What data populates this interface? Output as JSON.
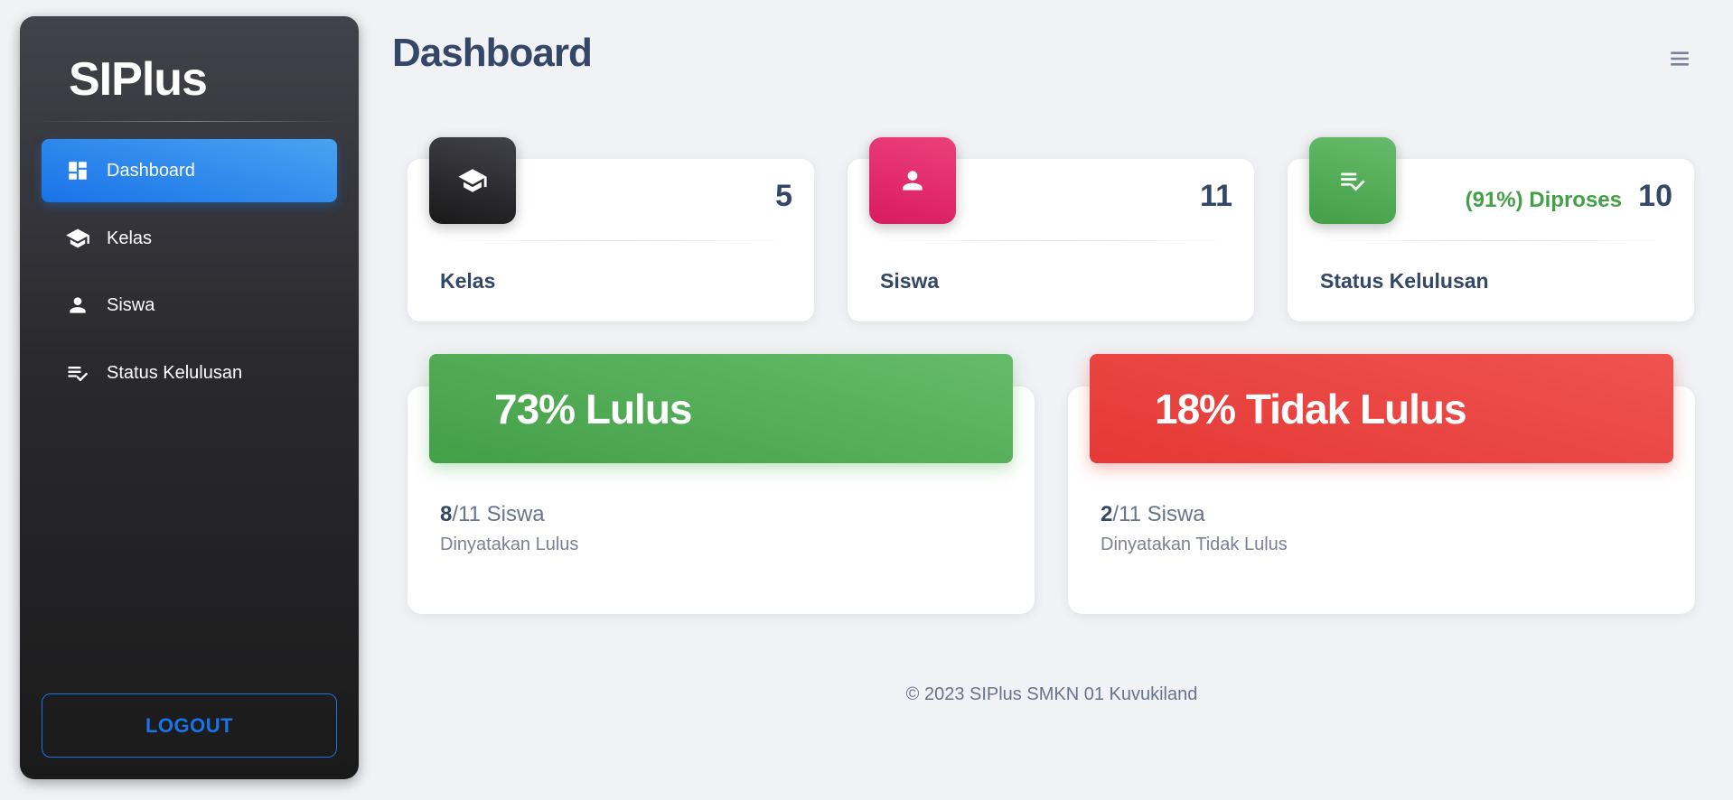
{
  "sidebar": {
    "brand": "SIPlus",
    "items": [
      {
        "label": "Dashboard",
        "icon": "dashboard-icon",
        "active": true
      },
      {
        "label": "Kelas",
        "icon": "school-icon",
        "active": false
      },
      {
        "label": "Siswa",
        "icon": "person-icon",
        "active": false
      },
      {
        "label": "Status Kelulusan",
        "icon": "checklist-icon",
        "active": false
      }
    ],
    "logout_label": "LOGOUT"
  },
  "header": {
    "title": "Dashboard",
    "menu_icon": "menu-icon"
  },
  "stats": [
    {
      "label": "Kelas",
      "value": "5",
      "icon": "school-icon",
      "color": "#222222"
    },
    {
      "label": "Siswa",
      "value": "11",
      "icon": "person-icon",
      "color": "#e91e63"
    },
    {
      "label": "Status Kelulusan",
      "value": "10",
      "extra": "(91%) Diproses",
      "icon": "checklist-icon",
      "color": "#4caf50"
    }
  ],
  "results": [
    {
      "title": "73% Lulus",
      "count": "8",
      "total": "/11 Siswa",
      "subtitle": "Dinyatakan Lulus",
      "color": "#4caf50"
    },
    {
      "title": "18% Tidak Lulus",
      "count": "2",
      "total": "/11 Siswa",
      "subtitle": "Dinyatakan Tidak Lulus",
      "color": "#e53935"
    }
  ],
  "footer": {
    "text": "© 2023 SIPlus SMKN 01 Kuvukiland"
  }
}
